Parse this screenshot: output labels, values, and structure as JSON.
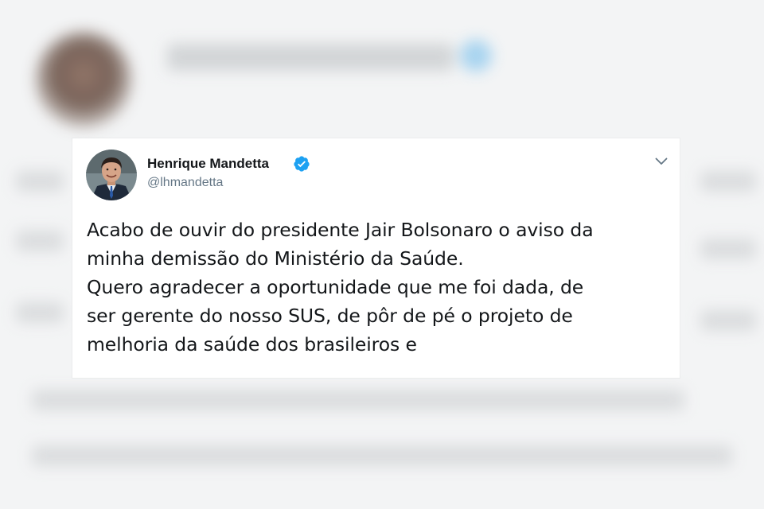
{
  "tweet": {
    "author_name": "Henrique Mandetta",
    "author_handle": "@lhmandetta",
    "verified": true,
    "text_lines": [
      "Acabo de ouvir do presidente Jair Bolsonaro o aviso da",
      "minha demissão do Ministério da Saúde.",
      "Quero agradecer a oportunidade que me foi dada, de",
      "ser gerente do nosso SUS, de pôr de pé o projeto de",
      "melhoria da saúde dos brasileiros e"
    ]
  },
  "colors": {
    "verified_badge": "#1da1f2",
    "handle": "#657786",
    "text": "#14171a",
    "card": "#ffffff",
    "background": "#f3f4f5"
  },
  "icons": {
    "verified": "verified-badge-icon",
    "caret": "chevron-down-icon"
  }
}
